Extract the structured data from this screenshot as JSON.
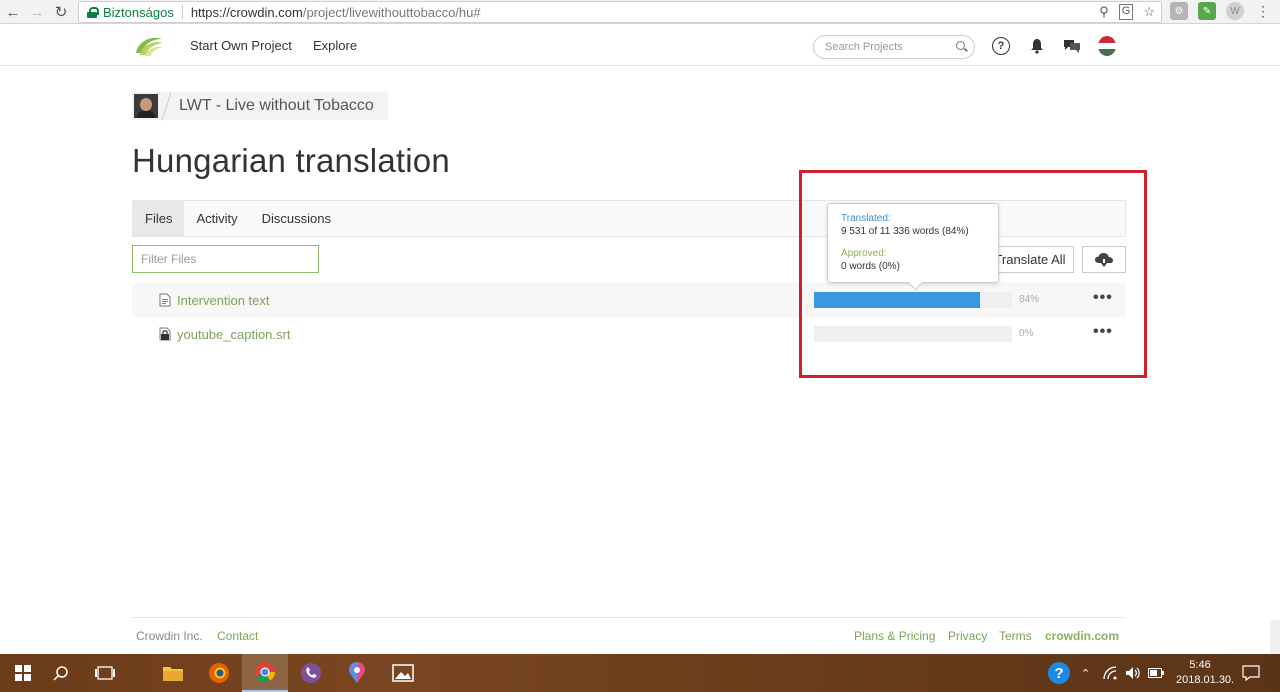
{
  "browser": {
    "secure_label": "Biztonságos",
    "url_host": "https://crowdin.com",
    "url_path": "/project/livewithouttobacco/hu#"
  },
  "header": {
    "nav": [
      "Start Own Project",
      "Explore"
    ],
    "search_placeholder": "Search Projects"
  },
  "project": {
    "name": "LWT - Live without Tobacco",
    "title": "Hungarian translation"
  },
  "tabs": [
    "Files",
    "Activity",
    "Discussions"
  ],
  "filter_placeholder": "Filter Files",
  "translate_all_label": "Translate All",
  "files": [
    {
      "name": "Intervention text",
      "progress": 84,
      "progress_label": "84%"
    },
    {
      "name": "youtube_caption.srt",
      "progress": 0,
      "progress_label": "0%"
    }
  ],
  "tooltip": {
    "translated_label": "Translated:",
    "translated_value": "9 531 of 11 336 words (84%)",
    "approved_label": "Approved:",
    "approved_value": "0 words (0%)"
  },
  "footer": {
    "company": "Crowdin Inc.",
    "contact": "Contact",
    "plans": "Plans & Pricing",
    "privacy": "Privacy",
    "terms": "Terms",
    "brand": "crowdin.com"
  },
  "taskbar": {
    "time": "5:46",
    "date": "2018.01.30."
  },
  "colors": {
    "accent_green": "#7fa25a",
    "progress_blue": "#3b99e2",
    "highlight_red": "#d21f2b"
  }
}
